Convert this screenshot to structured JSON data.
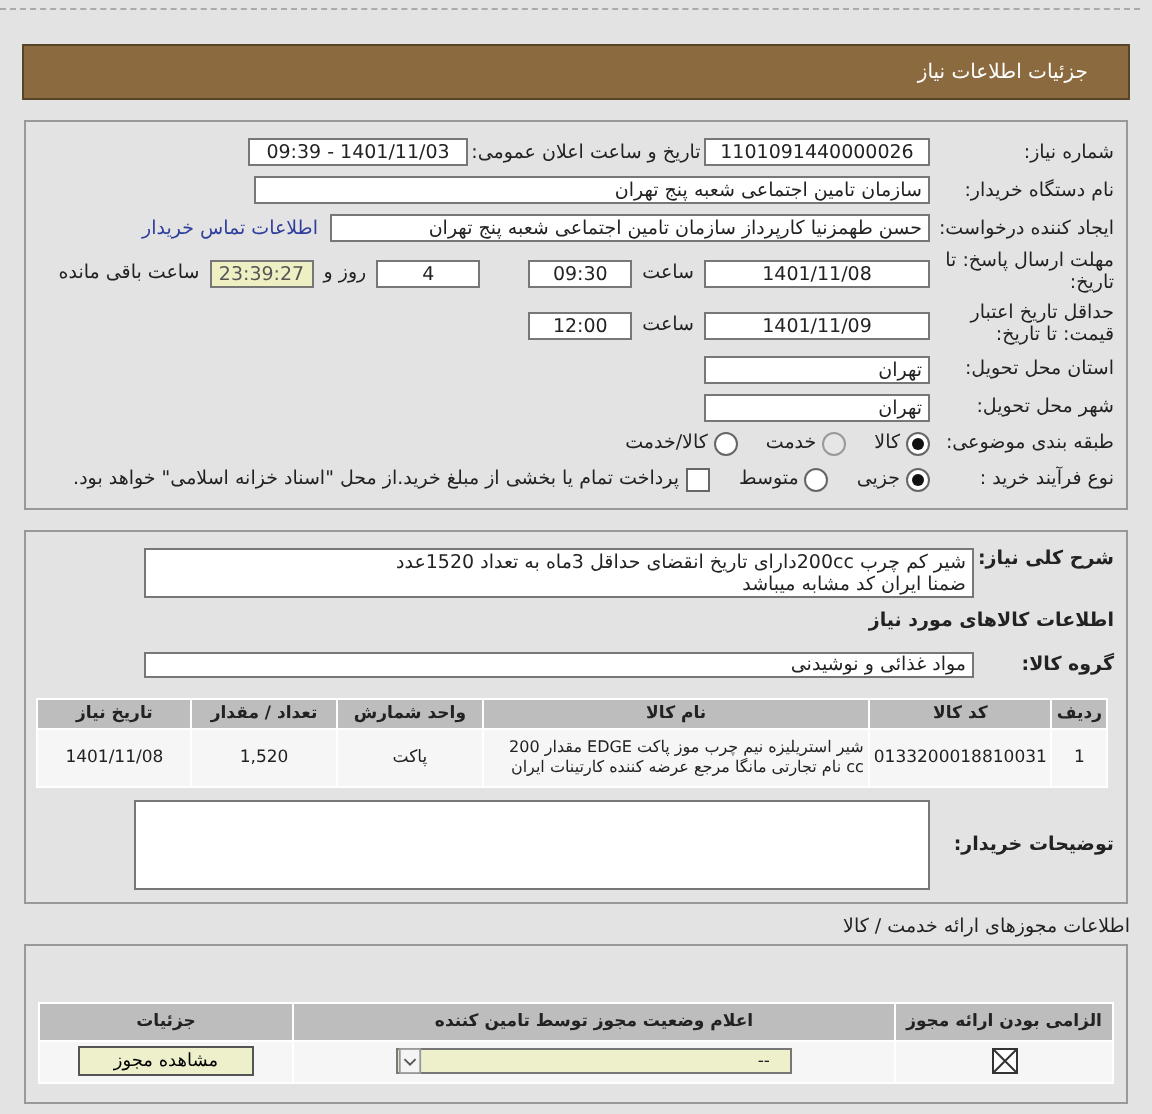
{
  "header": {
    "title": "جزئیات اطلاعات نیاز"
  },
  "need_info": {
    "need_number": {
      "label": "شماره نیاز:",
      "value": "1101091440000026"
    },
    "announce": {
      "label": "تاریخ و ساعت اعلان عمومی:",
      "value": "1401/11/03 - 09:39"
    },
    "buyer": {
      "label": "نام دستگاه خریدار:",
      "value": "سازمان تامین اجتماعی شعبه پنج تهران"
    },
    "creator": {
      "label": "ایجاد کننده درخواست:",
      "value": "حسن طهمزنیا کارپرداز سازمان تامین اجتماعی شعبه پنج تهران",
      "link": "اطلاعات تماس خریدار"
    },
    "deadline": {
      "label": "مهلت ارسال پاسخ: تا تاریخ:",
      "date": "1401/11/08",
      "time_label": "ساعت",
      "time": "09:30",
      "days": "4",
      "days_label": "روز و",
      "remaining": "23:39:27",
      "remaining_label": "ساعت باقی مانده"
    },
    "validity": {
      "label": "حداقل تاریخ اعتبار قیمت: تا تاریخ:",
      "date": "1401/11/09",
      "time_label": "ساعت",
      "time": "12:00"
    },
    "province": {
      "label": "استان محل تحویل:",
      "value": "تهران"
    },
    "city": {
      "label": "شهر محل تحویل:",
      "value": "تهران"
    },
    "category": {
      "label": "طبقه بندی موضوعی:",
      "options": [
        {
          "label": "کالا",
          "selected": true,
          "disabled": false
        },
        {
          "label": "خدمت",
          "selected": false,
          "disabled": true
        },
        {
          "label": "کالا/خدمت",
          "selected": false,
          "disabled": false
        }
      ]
    },
    "purchase": {
      "label": "نوع فرآیند خرید :",
      "options": [
        {
          "label": "جزیی",
          "selected": true,
          "disabled": false
        },
        {
          "label": "متوسط",
          "selected": false,
          "disabled": false
        }
      ],
      "checkbox": {
        "checked": false,
        "label": "پرداخت تمام یا بخشی از مبلغ خرید.از محل \"اسناد خزانه اسلامی\" خواهد بود."
      }
    }
  },
  "description": {
    "label": "شرح کلی نیاز:",
    "value": "شیر کم چرب 200ccدارای تاریخ انقضای حداقل 3ماه به تعداد 1520عدد\nضمنا ایران کد مشابه میباشد"
  },
  "goods": {
    "title": "اطلاعات کالاهای مورد نیاز",
    "group_label": "گروه کالا:",
    "group": "مواد غذائی و نوشیدنی",
    "columns": [
      "ردیف",
      "کد کالا",
      "نام کالا",
      "واحد شمارش",
      "تعداد / مقدار",
      "تاریخ نیاز"
    ],
    "rows": [
      [
        "1",
        "0133200018810031",
        "شیر استریلیزه نیم چرب موز پاکت EDGE مقدار 200 cc نام تجارتی مانگا مرجع عرضه کننده کارتینات ایران",
        "پاکت",
        "1,520",
        "1401/11/08"
      ]
    ]
  },
  "buyer_notes": {
    "label": "توضیحات خریدار:"
  },
  "licenses": {
    "title": "اطلاعات مجوزهای ارائه خدمت / کالا",
    "columns": [
      "الزامی بودن ارائه مجوز",
      "اعلام وضعیت مجوز توسط تامین کننده",
      "جزئیات"
    ],
    "rows": [
      {
        "required": true,
        "status": "--",
        "button": "مشاهده مجوز"
      }
    ]
  }
}
